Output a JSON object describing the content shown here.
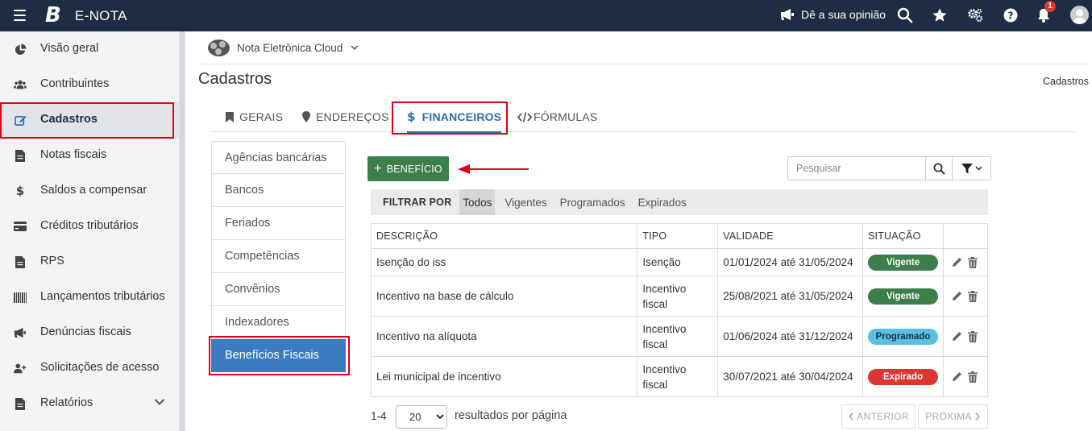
{
  "header": {
    "app_title": "E-NOTA",
    "logo_letter": "B",
    "feedback_label": "Dê a sua opinião",
    "notification_count": "1"
  },
  "sidebar": {
    "items": [
      {
        "label": "Visão geral",
        "icon": "pie-chart-icon"
      },
      {
        "label": "Contribuintes",
        "icon": "users-icon"
      },
      {
        "label": "Cadastros",
        "icon": "edit-icon",
        "active": true
      },
      {
        "label": "Notas fiscais",
        "icon": "file-icon"
      },
      {
        "label": "Saldos a compensar",
        "icon": "dollar-icon"
      },
      {
        "label": "Créditos tributários",
        "icon": "credit-card-icon"
      },
      {
        "label": "RPS",
        "icon": "file-icon"
      },
      {
        "label": "Lançamentos tributários",
        "icon": "barcode-icon"
      },
      {
        "label": "Denúncias fiscais",
        "icon": "megaphone-icon"
      },
      {
        "label": "Solicitações de acesso",
        "icon": "user-plus-icon"
      },
      {
        "label": "Relatórios",
        "icon": "file-icon"
      }
    ]
  },
  "company": {
    "name": "Nota Eletrônica Cloud"
  },
  "page": {
    "title": "Cadastros",
    "breadcrumb": "Cadastros"
  },
  "tabs": [
    {
      "label": "GERAIS",
      "icon": "bookmark-icon"
    },
    {
      "label": "ENDEREÇOS",
      "icon": "map-marker-icon"
    },
    {
      "label": "FINANCEIROS",
      "icon": "dollar-icon",
      "active": true
    },
    {
      "label": "FÓRMULAS",
      "icon": "code-icon"
    }
  ],
  "subnav": [
    "Agências bancárias",
    "Bancos",
    "Feriados",
    "Competências",
    "Convênios",
    "Indexadores",
    "Benefícios Fiscais"
  ],
  "toolbar": {
    "add_label": "BENEFÍCIO",
    "search_placeholder": "Pesquisar"
  },
  "filter": {
    "label": "FILTRAR POR",
    "options": [
      "Todos",
      "Vigentes",
      "Programados",
      "Expirados"
    ],
    "selected": "Todos"
  },
  "table": {
    "headers": [
      "DESCRIÇÃO",
      "TIPO",
      "VALIDADE",
      "SITUAÇÃO"
    ],
    "rows": [
      {
        "descricao": "Isenção do iss",
        "tipo": "Isenção",
        "validade": "01/01/2024 até 31/05/2024",
        "situacao": "Vigente"
      },
      {
        "descricao": "Incentivo na base de cálculo",
        "tipo": "Incentivo fiscal",
        "validade": "25/08/2021 até 31/05/2024",
        "situacao": "Vigente"
      },
      {
        "descricao": "Incentivo na alíquota",
        "tipo": "Incentivo fiscal",
        "validade": "01/06/2024 até 31/12/2024",
        "situacao": "Programado"
      },
      {
        "descricao": "Lei municipal de incentivo",
        "tipo": "Incentivo fiscal",
        "validade": "30/07/2021 até 30/04/2024",
        "situacao": "Expirado"
      }
    ]
  },
  "status_colors": {
    "Vigente": "#3d7f4b",
    "Programado": "#5bc0de",
    "Expirado": "#d9372f"
  },
  "pagination": {
    "range": "1-4",
    "page_size": "20",
    "page_size_options": [
      "20"
    ],
    "per_page_label": "resultados por página",
    "prev_label": "ANTERIOR",
    "next_label": "PRÓXIMA"
  },
  "colors": {
    "topbar": "#1f2d44",
    "accent": "#2f6da9",
    "active_subnav": "#3b7bbf",
    "primary_button": "#3d7f4b",
    "annotation": "#e00016"
  }
}
